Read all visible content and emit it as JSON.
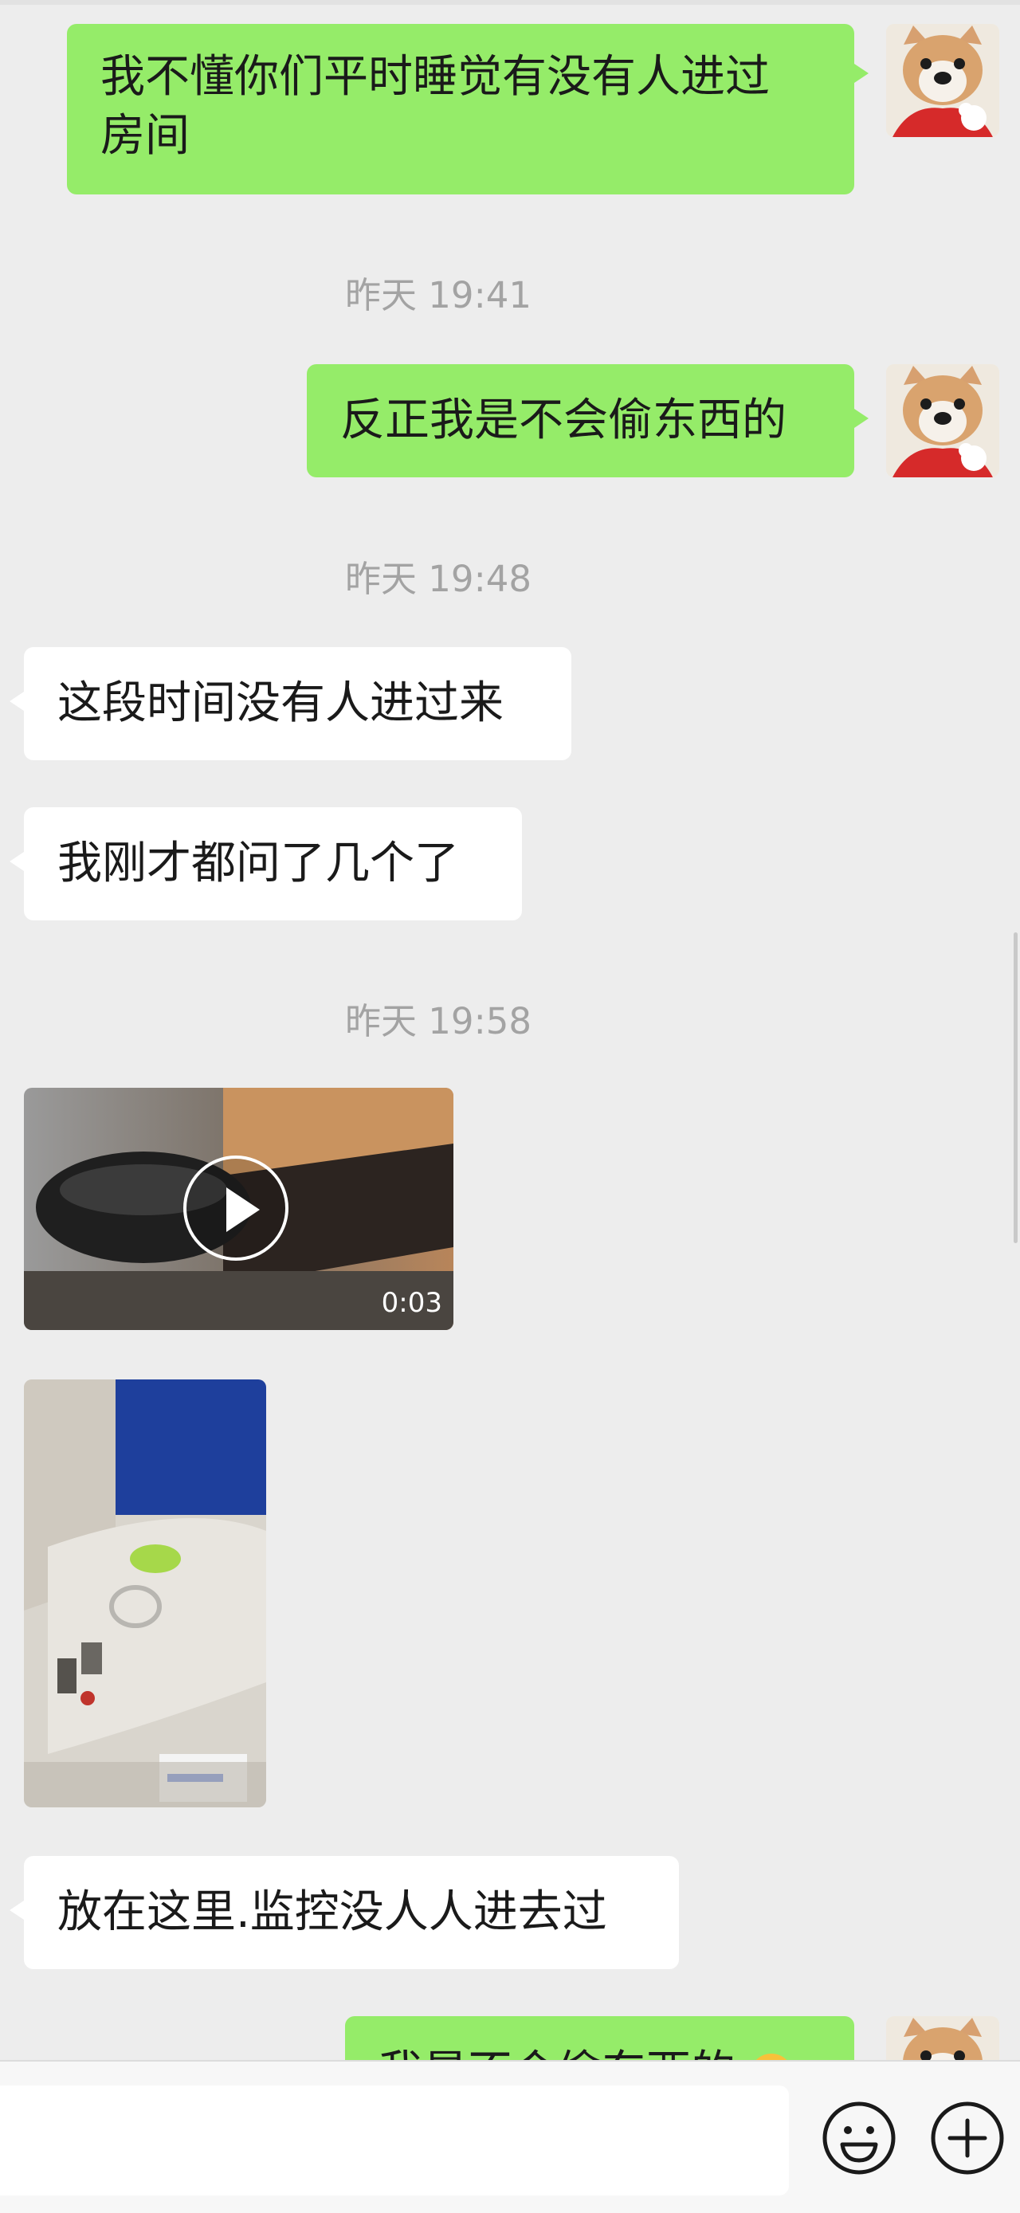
{
  "messages": [
    {
      "side": "me",
      "text_line1": "我不懂你们平时睡觉有没有人进过",
      "text_line2": "房间"
    },
    {
      "timestamp": "昨天 19:41"
    },
    {
      "side": "me",
      "text": "反正我是不会偷东西的"
    },
    {
      "timestamp": "昨天 19:48"
    },
    {
      "side": "them",
      "text": "这段时间没有人进过来"
    },
    {
      "side": "them",
      "text": "我刚才都问了几个了"
    },
    {
      "timestamp": "昨天 19:58"
    },
    {
      "side": "them",
      "type": "video",
      "duration": "0:03",
      "icon": "play-icon"
    },
    {
      "side": "them",
      "type": "image"
    },
    {
      "side": "them",
      "text": "放在这里.监控没人人进去过"
    },
    {
      "side": "me",
      "text": "我是不会偷东西的",
      "emoji": "smile-emoji"
    }
  ],
  "input_bar": {
    "emoji_button_icon": "smiley-icon",
    "more_button_icon": "plus-circle-icon"
  },
  "colors": {
    "my_bubble": "#95ec69",
    "their_bubble": "#ffffff",
    "background": "#ededed",
    "timestamp": "#a3a3a3"
  }
}
